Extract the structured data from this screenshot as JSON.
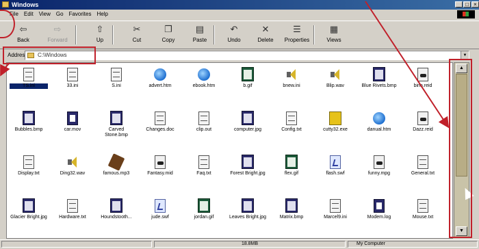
{
  "window": {
    "title": "Windows"
  },
  "menu": [
    "File",
    "Edit",
    "View",
    "Go",
    "Favorites",
    "Help"
  ],
  "toolbar": [
    {
      "label": "Back",
      "icon": "back-arrow-icon",
      "glyph": "⇦"
    },
    {
      "label": "Forward",
      "icon": "forward-arrow-icon",
      "glyph": "⇨"
    },
    {
      "label": "Up",
      "icon": "up-folder-icon",
      "glyph": "⇧"
    },
    {
      "label": "Cut",
      "icon": "scissors-icon",
      "glyph": "✂"
    },
    {
      "label": "Copy",
      "icon": "copy-icon",
      "glyph": "❐"
    },
    {
      "label": "Paste",
      "icon": "clipboard-icon",
      "glyph": "▤"
    },
    {
      "label": "Undo",
      "icon": "undo-icon",
      "glyph": "↶"
    },
    {
      "label": "Delete",
      "icon": "delete-x-icon",
      "glyph": "✕"
    },
    {
      "label": "Properties",
      "icon": "properties-icon",
      "glyph": "☰"
    },
    {
      "label": "Views",
      "icon": "views-icon",
      "glyph": "▦"
    }
  ],
  "address": {
    "label": "Address",
    "path": "C:\\Windows"
  },
  "files": [
    {
      "name": "TS.ini",
      "type": "doc"
    },
    {
      "name": "33.ini",
      "type": "doc"
    },
    {
      "name": "S.ini",
      "type": "doc"
    },
    {
      "name": "advert.htm",
      "type": "ie"
    },
    {
      "name": "ebook.htm",
      "type": "ie"
    },
    {
      "name": "b.gif",
      "type": "gif"
    },
    {
      "name": "bnew.ini",
      "type": "snd"
    },
    {
      "name": "Blip.wav",
      "type": "snd"
    },
    {
      "name": "Blue Rivets.bmp",
      "type": "pic"
    },
    {
      "name": "bino.reid",
      "type": "mid"
    },
    {
      "name": "Bubbles.bmp",
      "type": "pic"
    },
    {
      "name": "car.mov",
      "type": "hlp"
    },
    {
      "name": "Carved Stone.bmp",
      "type": "pic"
    },
    {
      "name": "Changes.doc",
      "type": "doc"
    },
    {
      "name": "clip.out",
      "type": "doc"
    },
    {
      "name": "computer.jpg",
      "type": "pic"
    },
    {
      "name": "Config.txt",
      "type": "doc"
    },
    {
      "name": "cutty32.exe",
      "type": "yel"
    },
    {
      "name": "danual.htm",
      "type": "ie"
    },
    {
      "name": "Dazz.reid",
      "type": "mid"
    },
    {
      "name": "Display.txt",
      "type": "doc"
    },
    {
      "name": "Ding32.wav",
      "type": "snd"
    },
    {
      "name": "famous.mp3",
      "type": "cd"
    },
    {
      "name": "Fantasy.mid",
      "type": "mid"
    },
    {
      "name": "Faq.txt",
      "type": "doc"
    },
    {
      "name": "Forest Bright.jpg",
      "type": "pic"
    },
    {
      "name": "flex.gif",
      "type": "gif"
    },
    {
      "name": "flash.swf",
      "type": "swf"
    },
    {
      "name": "funny.mpg",
      "type": "mid"
    },
    {
      "name": "General.txt",
      "type": "doc"
    },
    {
      "name": "Glacier Bright.jpg",
      "type": "pic"
    },
    {
      "name": "Hardware.txt",
      "type": "doc"
    },
    {
      "name": "Houndstooth...",
      "type": "pic"
    },
    {
      "name": "jude.swf",
      "type": "swf"
    },
    {
      "name": "jordan.gif",
      "type": "gif"
    },
    {
      "name": "Leaves Bright.jpg",
      "type": "pic"
    },
    {
      "name": "Matrix.bmp",
      "type": "pic"
    },
    {
      "name": "Marcel9.ini",
      "type": "doc"
    },
    {
      "name": "Modem.log",
      "type": "hlp"
    },
    {
      "name": "Mouse.txt",
      "type": "doc"
    }
  ],
  "status": {
    "left": "",
    "middle": "18.8MB",
    "right": "My Computer"
  },
  "colors": {
    "titlebar": "#0a246a",
    "callout": "#c0202a",
    "window_bg": "#d4d0c8"
  }
}
